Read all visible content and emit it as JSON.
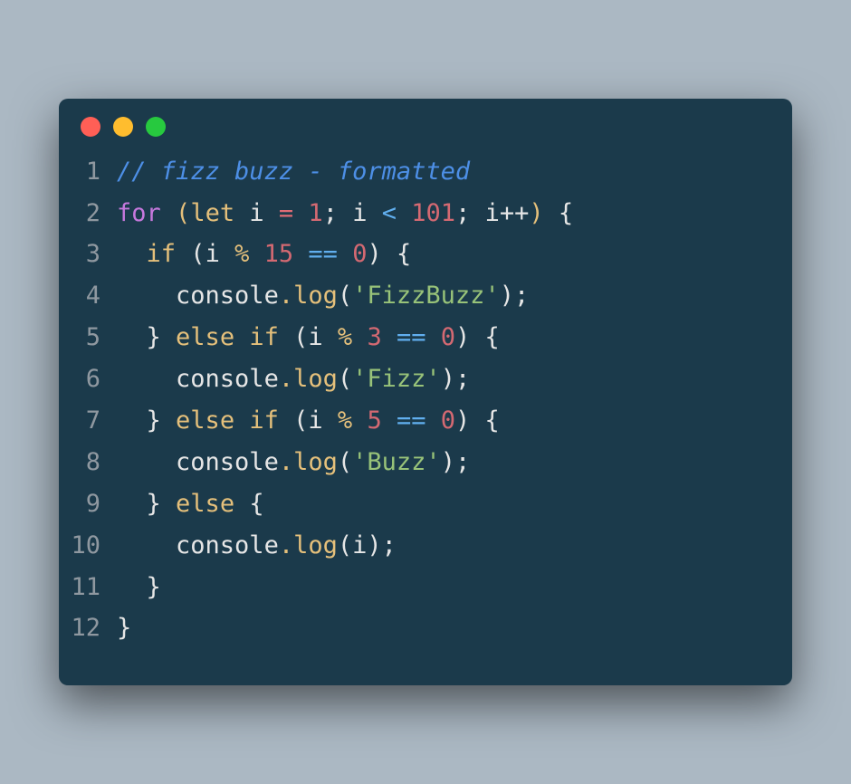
{
  "lines": [
    {
      "num": "1",
      "tokens": [
        {
          "cls": "comment",
          "t": "// fizz buzz - formatted"
        }
      ]
    },
    {
      "num": "2",
      "tokens": [
        {
          "cls": "kw-for",
          "t": "for"
        },
        {
          "cls": "op",
          "t": " "
        },
        {
          "cls": "paren",
          "t": "("
        },
        {
          "cls": "kw-let",
          "t": "let"
        },
        {
          "cls": "op",
          "t": " "
        },
        {
          "cls": "ident",
          "t": "i"
        },
        {
          "cls": "op",
          "t": " "
        },
        {
          "cls": "eq-assign",
          "t": "="
        },
        {
          "cls": "op",
          "t": " "
        },
        {
          "cls": "num",
          "t": "1"
        },
        {
          "cls": "semi",
          "t": ";"
        },
        {
          "cls": "op",
          "t": " "
        },
        {
          "cls": "ident",
          "t": "i"
        },
        {
          "cls": "op",
          "t": " "
        },
        {
          "cls": "op-cmp",
          "t": "<"
        },
        {
          "cls": "op",
          "t": " "
        },
        {
          "cls": "num",
          "t": "101"
        },
        {
          "cls": "semi",
          "t": ";"
        },
        {
          "cls": "op",
          "t": " "
        },
        {
          "cls": "ident",
          "t": "i"
        },
        {
          "cls": "op-inc",
          "t": "++"
        },
        {
          "cls": "paren",
          "t": ")"
        },
        {
          "cls": "op",
          "t": " "
        },
        {
          "cls": "brace",
          "t": "{"
        }
      ]
    },
    {
      "num": "3",
      "tokens": [
        {
          "cls": "op",
          "t": "  "
        },
        {
          "cls": "kw-cond",
          "t": "if"
        },
        {
          "cls": "op",
          "t": " "
        },
        {
          "cls": "paren-w",
          "t": "("
        },
        {
          "cls": "ident",
          "t": "i"
        },
        {
          "cls": "op",
          "t": " "
        },
        {
          "cls": "op-mod",
          "t": "%"
        },
        {
          "cls": "op",
          "t": " "
        },
        {
          "cls": "num",
          "t": "15"
        },
        {
          "cls": "op",
          "t": " "
        },
        {
          "cls": "op-eq",
          "t": "=="
        },
        {
          "cls": "op",
          "t": " "
        },
        {
          "cls": "num",
          "t": "0"
        },
        {
          "cls": "paren-w",
          "t": ")"
        },
        {
          "cls": "op",
          "t": " "
        },
        {
          "cls": "brace",
          "t": "{"
        }
      ]
    },
    {
      "num": "4",
      "tokens": [
        {
          "cls": "op",
          "t": "    "
        },
        {
          "cls": "obj",
          "t": "console"
        },
        {
          "cls": "dot-op",
          "t": "."
        },
        {
          "cls": "fn",
          "t": "log"
        },
        {
          "cls": "paren-w",
          "t": "("
        },
        {
          "cls": "str",
          "t": "'FizzBuzz'"
        },
        {
          "cls": "paren-w",
          "t": ")"
        },
        {
          "cls": "semi",
          "t": ";"
        }
      ]
    },
    {
      "num": "5",
      "tokens": [
        {
          "cls": "op",
          "t": "  "
        },
        {
          "cls": "brace",
          "t": "}"
        },
        {
          "cls": "op",
          "t": " "
        },
        {
          "cls": "kw-cond",
          "t": "else if"
        },
        {
          "cls": "op",
          "t": " "
        },
        {
          "cls": "paren-w",
          "t": "("
        },
        {
          "cls": "ident",
          "t": "i"
        },
        {
          "cls": "op",
          "t": " "
        },
        {
          "cls": "op-mod",
          "t": "%"
        },
        {
          "cls": "op",
          "t": " "
        },
        {
          "cls": "num",
          "t": "3"
        },
        {
          "cls": "op",
          "t": " "
        },
        {
          "cls": "op-eq",
          "t": "=="
        },
        {
          "cls": "op",
          "t": " "
        },
        {
          "cls": "num",
          "t": "0"
        },
        {
          "cls": "paren-w",
          "t": ")"
        },
        {
          "cls": "op",
          "t": " "
        },
        {
          "cls": "brace",
          "t": "{"
        }
      ]
    },
    {
      "num": "6",
      "tokens": [
        {
          "cls": "op",
          "t": "    "
        },
        {
          "cls": "obj",
          "t": "console"
        },
        {
          "cls": "dot-op",
          "t": "."
        },
        {
          "cls": "fn",
          "t": "log"
        },
        {
          "cls": "paren-w",
          "t": "("
        },
        {
          "cls": "str",
          "t": "'Fizz'"
        },
        {
          "cls": "paren-w",
          "t": ")"
        },
        {
          "cls": "semi",
          "t": ";"
        }
      ]
    },
    {
      "num": "7",
      "tokens": [
        {
          "cls": "op",
          "t": "  "
        },
        {
          "cls": "brace",
          "t": "}"
        },
        {
          "cls": "op",
          "t": " "
        },
        {
          "cls": "kw-cond",
          "t": "else if"
        },
        {
          "cls": "op",
          "t": " "
        },
        {
          "cls": "paren-w",
          "t": "("
        },
        {
          "cls": "ident",
          "t": "i"
        },
        {
          "cls": "op",
          "t": " "
        },
        {
          "cls": "op-mod",
          "t": "%"
        },
        {
          "cls": "op",
          "t": " "
        },
        {
          "cls": "num",
          "t": "5"
        },
        {
          "cls": "op",
          "t": " "
        },
        {
          "cls": "op-eq",
          "t": "=="
        },
        {
          "cls": "op",
          "t": " "
        },
        {
          "cls": "num",
          "t": "0"
        },
        {
          "cls": "paren-w",
          "t": ")"
        },
        {
          "cls": "op",
          "t": " "
        },
        {
          "cls": "brace",
          "t": "{"
        }
      ]
    },
    {
      "num": "8",
      "tokens": [
        {
          "cls": "op",
          "t": "    "
        },
        {
          "cls": "obj",
          "t": "console"
        },
        {
          "cls": "dot-op",
          "t": "."
        },
        {
          "cls": "fn",
          "t": "log"
        },
        {
          "cls": "paren-w",
          "t": "("
        },
        {
          "cls": "str",
          "t": "'Buzz'"
        },
        {
          "cls": "paren-w",
          "t": ")"
        },
        {
          "cls": "semi",
          "t": ";"
        }
      ]
    },
    {
      "num": "9",
      "tokens": [
        {
          "cls": "op",
          "t": "  "
        },
        {
          "cls": "brace",
          "t": "}"
        },
        {
          "cls": "op",
          "t": " "
        },
        {
          "cls": "kw-cond",
          "t": "else"
        },
        {
          "cls": "op",
          "t": " "
        },
        {
          "cls": "brace",
          "t": "{"
        }
      ]
    },
    {
      "num": "10",
      "tokens": [
        {
          "cls": "op",
          "t": "    "
        },
        {
          "cls": "obj",
          "t": "console"
        },
        {
          "cls": "dot-op",
          "t": "."
        },
        {
          "cls": "fn",
          "t": "log"
        },
        {
          "cls": "paren-w",
          "t": "("
        },
        {
          "cls": "ident",
          "t": "i"
        },
        {
          "cls": "paren-w",
          "t": ")"
        },
        {
          "cls": "semi",
          "t": ";"
        }
      ]
    },
    {
      "num": "11",
      "tokens": [
        {
          "cls": "op",
          "t": "  "
        },
        {
          "cls": "brace",
          "t": "}"
        }
      ]
    },
    {
      "num": "12",
      "tokens": [
        {
          "cls": "brace",
          "t": "}"
        }
      ]
    }
  ]
}
